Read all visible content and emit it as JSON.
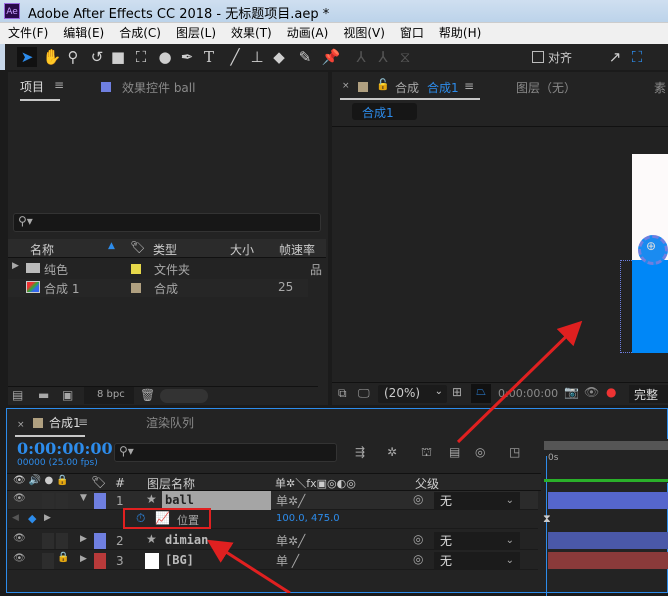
{
  "window": {
    "app_icon": "Ae",
    "title": "Adobe After Effects CC 2018 - 无标题项目.aep *"
  },
  "menu": [
    "文件(F)",
    "编辑(E)",
    "合成(C)",
    "图层(L)",
    "效果(T)",
    "动画(A)",
    "视图(V)",
    "窗口",
    "帮助(H)"
  ],
  "toolbar": {
    "snap_label": "对齐"
  },
  "project_panel": {
    "tab": "项目",
    "effects_tab": "效果控件 ball",
    "columns": [
      "名称",
      "类型",
      "大小",
      "帧速率"
    ],
    "items": [
      {
        "name": "纯色",
        "type": "文件夹",
        "size": "",
        "fps": "",
        "color": "#e6d84a"
      },
      {
        "name": "合成 1",
        "type": "合成",
        "size": "",
        "fps": "25",
        "color": "#b0a080"
      }
    ],
    "bpc": "8 bpc"
  },
  "comp_panel": {
    "tab_prefix": "合成",
    "tab_name": "合成1",
    "layer_tab": "图层（无）",
    "footage_tab": "素",
    "sub_tab": "合成1",
    "zoom": "(20%)",
    "time": "0:00:00:00",
    "quality": "完整"
  },
  "timeline": {
    "tab": "合成1",
    "render_tab": "渲染队列",
    "timecode": "0:00:00:00",
    "fps": "00000 (25.00 fps)",
    "col_layer_name": "图层名称",
    "col_hash": "#",
    "col_parent": "父级",
    "col_switches": "单✲＼fx▣◎◐◎",
    "ruler": "0s",
    "layers": [
      {
        "num": "1",
        "name": "ball",
        "color": "#6f7fe0",
        "parent": "无"
      },
      {
        "num": "2",
        "name": "dimian",
        "color": "#6f7fe0",
        "parent": "无"
      },
      {
        "num": "3",
        "name": "[BG]",
        "color": "#b83a3a",
        "parent": "无"
      }
    ],
    "property": {
      "name": "位置",
      "value": "100.0, 475.0"
    }
  },
  "colors": {
    "accent": "#2d8ceb",
    "highlight": "#e02020"
  }
}
